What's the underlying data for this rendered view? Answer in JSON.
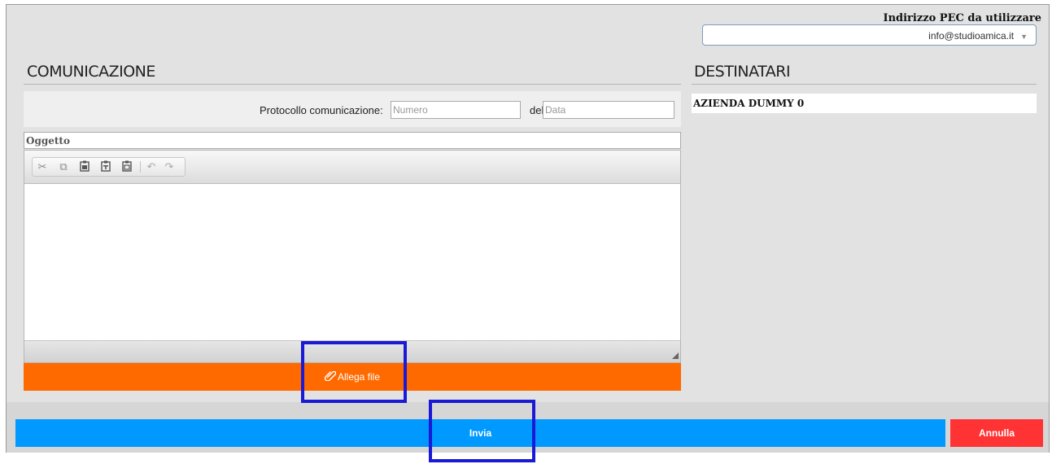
{
  "pec": {
    "label": "Indirizzo PEC da utilizzare",
    "selected": "info@studioamica.it",
    "arrow": "▼"
  },
  "communication": {
    "title": "COMUNICAZIONE",
    "protocol_label": "Protocollo comunicazione:",
    "number_placeholder": "Numero",
    "date_label": "del",
    "date_placeholder": "Data",
    "subject_placeholder": "Oggetto",
    "toolbar_icons": [
      "cut-icon",
      "copy-icon",
      "paste-icon",
      "paste-text-icon",
      "paste-word-icon",
      "undo-icon",
      "redo-icon"
    ],
    "attach_label": "Allega file"
  },
  "recipients": {
    "title": "DESTINATARI",
    "items": [
      "AZIENDA DUMMY 0"
    ]
  },
  "actions": {
    "send_label": "Invia",
    "cancel_label": "Annulla"
  },
  "colors": {
    "attach_bar": "#ff6a00",
    "send": "#0099ff",
    "cancel": "#ff3333",
    "highlight": "#1a1ad6"
  }
}
